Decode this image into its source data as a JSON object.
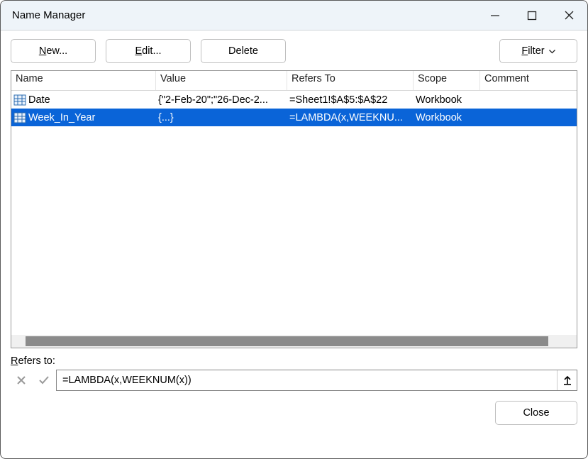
{
  "window": {
    "title": "Name Manager"
  },
  "toolbar": {
    "new_label": "New...",
    "edit_label": "Edit...",
    "delete_label": "Delete",
    "filter_label": "Filter"
  },
  "columns": {
    "name": "Name",
    "value": "Value",
    "refers": "Refers To",
    "scope": "Scope",
    "comment": "Comment"
  },
  "rows": [
    {
      "name": "Date",
      "value": "{\"2-Feb-20\";\"26-Dec-2...",
      "refers": "=Sheet1!$A$5:$A$22",
      "scope": "Workbook",
      "comment": "",
      "selected": false
    },
    {
      "name": "Week_In_Year",
      "value": "{...}",
      "refers": "=LAMBDA(x,WEEKNU...",
      "scope": "Workbook",
      "comment": "",
      "selected": true
    }
  ],
  "refers_section": {
    "label": "Refers to:",
    "value": "=LAMBDA(x,WEEKNUM(x))"
  },
  "footer": {
    "close_label": "Close"
  }
}
